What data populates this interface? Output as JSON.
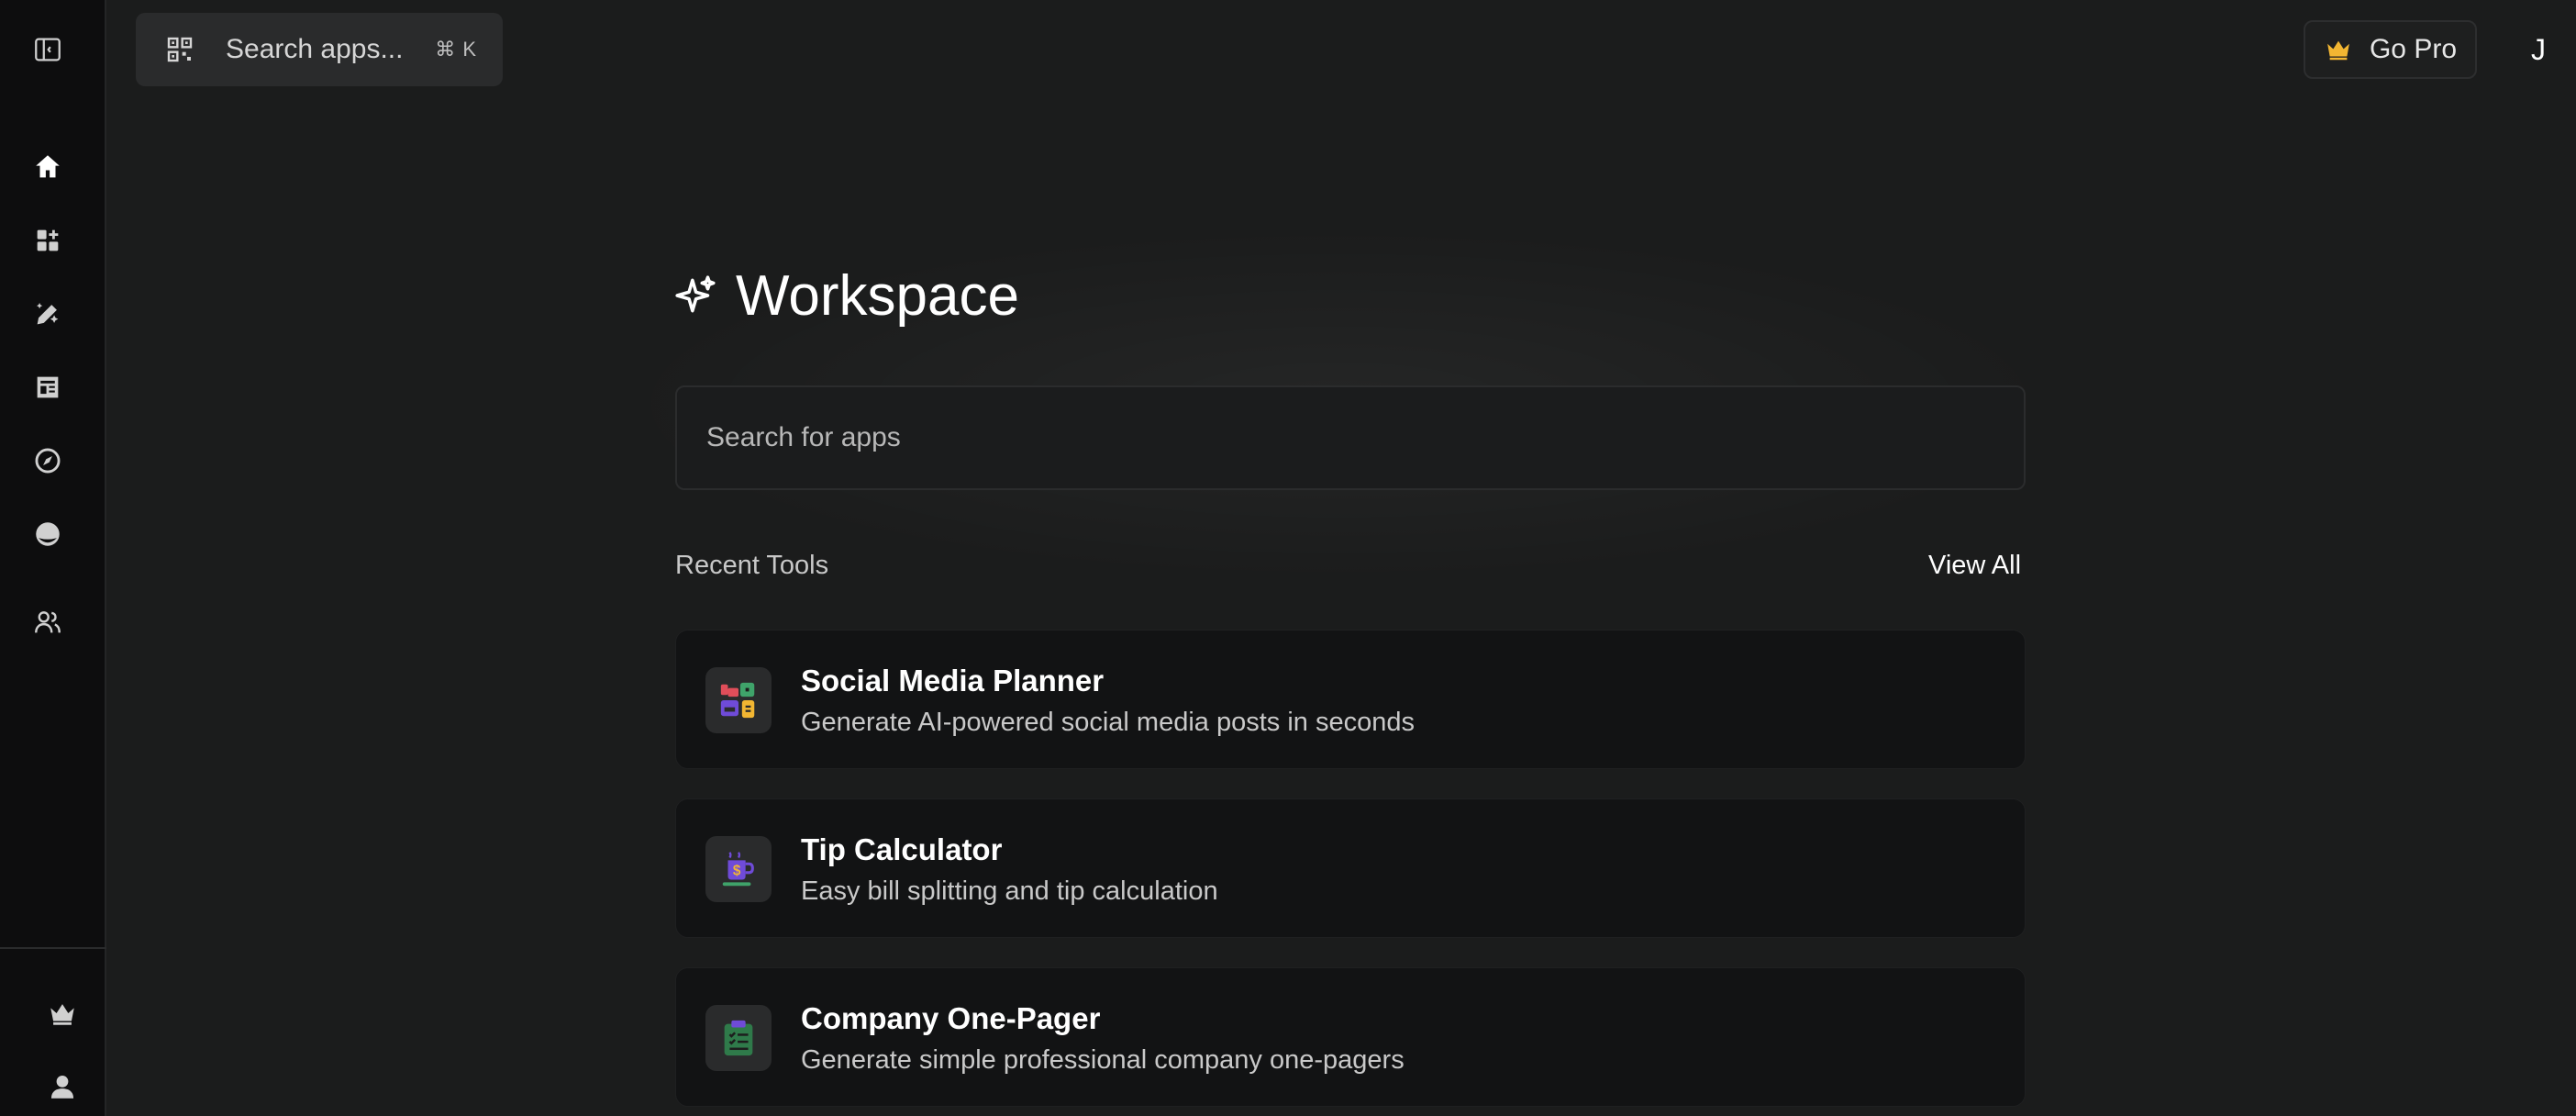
{
  "topbar": {
    "search_label": "Search apps...",
    "search_shortcut": "⌘ K",
    "go_pro_label": "Go Pro",
    "avatar_letter": "J"
  },
  "sidebar": {
    "items": [
      {
        "icon": "panel-toggle-icon"
      },
      {
        "icon": "home-icon"
      },
      {
        "icon": "apps-add-icon"
      },
      {
        "icon": "edit-sparkle-icon"
      },
      {
        "icon": "newspaper-icon"
      },
      {
        "icon": "compass-icon"
      },
      {
        "icon": "face-icon"
      },
      {
        "icon": "users-icon"
      },
      {
        "icon": "crown-icon"
      },
      {
        "icon": "profile-icon"
      }
    ]
  },
  "main": {
    "title": "Workspace",
    "search_placeholder": "Search for apps",
    "recent_label": "Recent Tools",
    "view_all_label": "View All",
    "tools": [
      {
        "title": "Social Media Planner",
        "description": "Generate AI-powered social media posts in seconds",
        "icon": "social-media-icon"
      },
      {
        "title": "Tip Calculator",
        "description": "Easy bill splitting and tip calculation",
        "icon": "tip-jar-icon"
      },
      {
        "title": "Company One-Pager",
        "description": "Generate simple professional company one-pagers",
        "icon": "clipboard-icon"
      }
    ]
  },
  "colors": {
    "background": "#1b1c1c",
    "sidebar": "#0d0d0e",
    "card": "#121314",
    "accent_gold": "#f2b632"
  }
}
